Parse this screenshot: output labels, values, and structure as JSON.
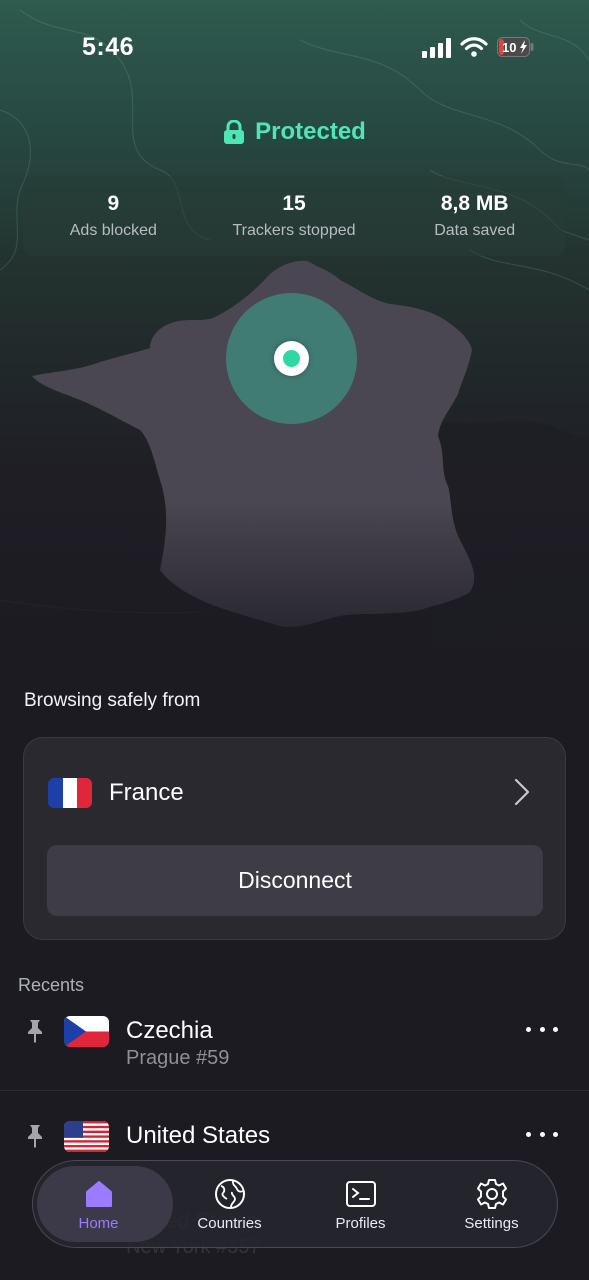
{
  "status_bar": {
    "time": "5:46",
    "battery": "10"
  },
  "connection": {
    "status": "Protected",
    "status_color": "#4ee6b5",
    "stats": [
      {
        "value": "9",
        "label": "Ads blocked"
      },
      {
        "value": "15",
        "label": "Trackers stopped"
      },
      {
        "value": "8,8 MB",
        "label": "Data saved"
      }
    ]
  },
  "location": {
    "heading": "Browsing safely from",
    "country": "France",
    "flag": "flag-france",
    "disconnect_label": "Disconnect"
  },
  "recents": {
    "title": "Recents",
    "items": [
      {
        "country": "Czechia",
        "server": "Prague #59",
        "flag": "flag-czechia",
        "pinned": true
      },
      {
        "country": "United States",
        "server": "New York #357",
        "flag": "flag-united-states",
        "pinned": true
      }
    ]
  },
  "tabbar": {
    "active_color": "#9b7bff",
    "items": [
      {
        "label": "Home",
        "icon": "home-icon",
        "active": true
      },
      {
        "label": "Countries",
        "icon": "globe-icon",
        "active": false
      },
      {
        "label": "Profiles",
        "icon": "terminal-icon",
        "active": false
      },
      {
        "label": "Settings",
        "icon": "gear-icon",
        "active": false
      }
    ]
  }
}
